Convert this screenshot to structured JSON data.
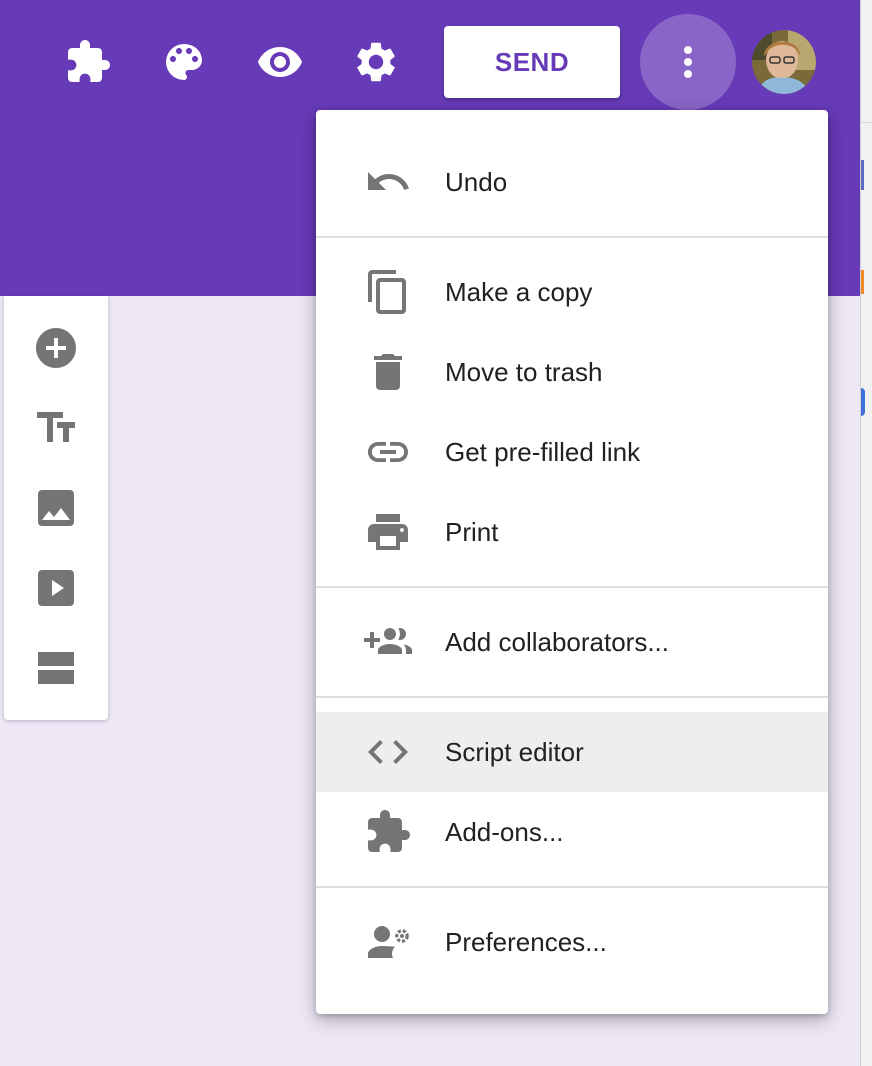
{
  "theme": {
    "accent": "#673ab7",
    "background": "#ede7f6",
    "icon_gray": "#757575"
  },
  "header": {
    "icons": [
      "puzzle-icon",
      "palette-icon",
      "eye-icon",
      "gear-icon"
    ],
    "send_label": "SEND",
    "more_icon": "more-vert-icon",
    "avatar": "user-avatar"
  },
  "toolbar": {
    "tools": [
      "add-question-icon",
      "title-text-icon",
      "image-icon",
      "video-icon",
      "section-icon"
    ]
  },
  "menu": {
    "items": [
      {
        "label": "Undo",
        "icon": "undo-icon"
      },
      {
        "label": "Make a copy",
        "icon": "copy-icon"
      },
      {
        "label": "Move to trash",
        "icon": "trash-icon"
      },
      {
        "label": "Get pre-filled link",
        "icon": "link-icon"
      },
      {
        "label": "Print",
        "icon": "print-icon"
      },
      {
        "label": "Add collaborators...",
        "icon": "add-people-icon"
      },
      {
        "label": "Script editor",
        "icon": "code-icon",
        "highlighted": true
      },
      {
        "label": "Add-ons...",
        "icon": "puzzle-icon"
      },
      {
        "label": "Preferences...",
        "icon": "person-settings-icon"
      }
    ]
  }
}
